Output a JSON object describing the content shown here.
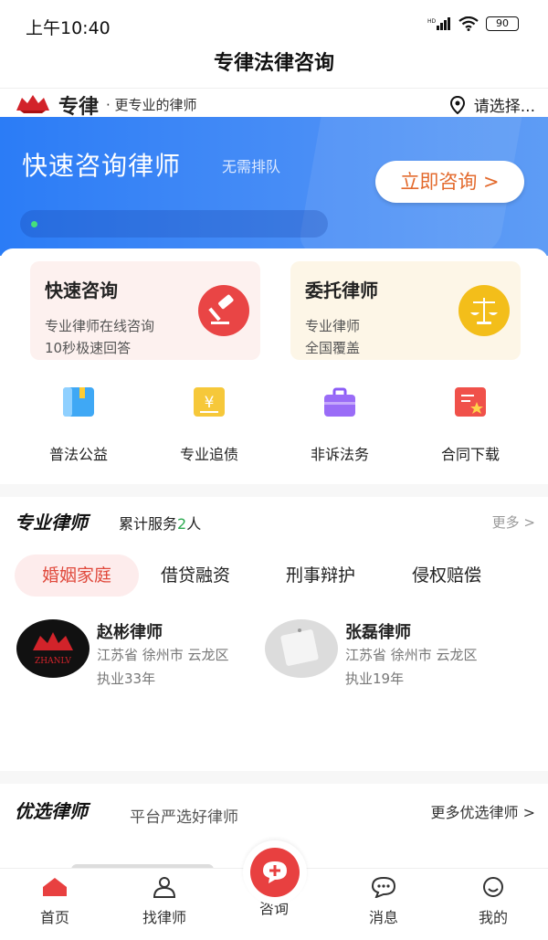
{
  "status_bar": {
    "time": "上午10:40",
    "battery": "90"
  },
  "header": {
    "title": "专律法律咨询"
  },
  "brand": {
    "name": "专律",
    "slogan": "· 更专业的律师",
    "location": "请选择..."
  },
  "banner": {
    "title": "快速咨询律师",
    "subtitle": "无需排队",
    "button": "立即咨询 >"
  },
  "cards": [
    {
      "title": "快速咨询",
      "line1": "专业律师在线咨询",
      "line2": "10秒极速回答"
    },
    {
      "title": "委托律师",
      "line1": "专业律师",
      "line2": "全国覆盖"
    }
  ],
  "grid": [
    {
      "label": "普法公益"
    },
    {
      "label": "专业追债"
    },
    {
      "label": "非诉法务"
    },
    {
      "label": "合同下载"
    }
  ],
  "lawyers_section": {
    "title": "专业律师",
    "count_prefix": "累计服务",
    "count": "2",
    "count_suffix": "人",
    "more": "更多 >"
  },
  "tabs": [
    "婚姻家庭",
    "借贷融资",
    "刑事辩护",
    "侵权赔偿"
  ],
  "lawyers": [
    {
      "name": "赵彬律师",
      "area": "江苏省 徐州市 云龙区",
      "years": "执业33年",
      "avatar_text": "ZHANLV"
    },
    {
      "name": "张磊律师",
      "area": "江苏省 徐州市 云龙区",
      "years": "执业19年"
    }
  ],
  "picked": {
    "title": "优选律师",
    "subtitle": "平台严选好律师",
    "more": "更多优选律师 >"
  },
  "nav": [
    "首页",
    "找律师",
    "咨询",
    "消息",
    "我的"
  ],
  "colors": {
    "primary": "#2b7cf6",
    "accent_red": "#e84040",
    "orange": "#e36a2d",
    "green": "#2aa94f"
  }
}
